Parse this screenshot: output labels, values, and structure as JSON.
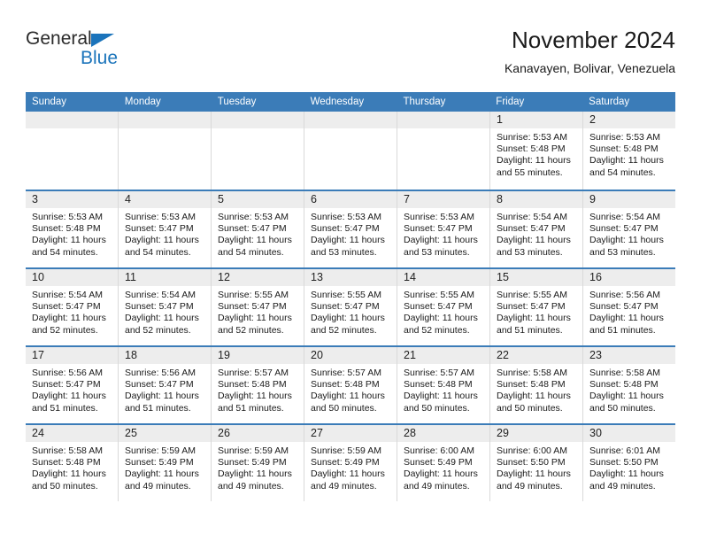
{
  "brand": {
    "name_part1": "General",
    "name_part2": "Blue",
    "accent_color": "#1b74bb"
  },
  "header": {
    "title": "November 2024",
    "subtitle": "Kanavayen, Bolivar, Venezuela"
  },
  "calendar": {
    "header_bg": "#3b7cb8",
    "daynum_bg": "#ededed",
    "weekdays": [
      "Sunday",
      "Monday",
      "Tuesday",
      "Wednesday",
      "Thursday",
      "Friday",
      "Saturday"
    ],
    "labels": {
      "sunrise": "Sunrise:",
      "sunset": "Sunset:",
      "daylight": "Daylight:"
    },
    "weeks": [
      [
        {
          "day": "",
          "empty": true
        },
        {
          "day": "",
          "empty": true
        },
        {
          "day": "",
          "empty": true
        },
        {
          "day": "",
          "empty": true
        },
        {
          "day": "",
          "empty": true
        },
        {
          "day": "1",
          "sunrise": "Sunrise: 5:53 AM",
          "sunset": "Sunset: 5:48 PM",
          "daylight": "Daylight: 11 hours and 55 minutes."
        },
        {
          "day": "2",
          "sunrise": "Sunrise: 5:53 AM",
          "sunset": "Sunset: 5:48 PM",
          "daylight": "Daylight: 11 hours and 54 minutes."
        }
      ],
      [
        {
          "day": "3",
          "sunrise": "Sunrise: 5:53 AM",
          "sunset": "Sunset: 5:48 PM",
          "daylight": "Daylight: 11 hours and 54 minutes."
        },
        {
          "day": "4",
          "sunrise": "Sunrise: 5:53 AM",
          "sunset": "Sunset: 5:47 PM",
          "daylight": "Daylight: 11 hours and 54 minutes."
        },
        {
          "day": "5",
          "sunrise": "Sunrise: 5:53 AM",
          "sunset": "Sunset: 5:47 PM",
          "daylight": "Daylight: 11 hours and 54 minutes."
        },
        {
          "day": "6",
          "sunrise": "Sunrise: 5:53 AM",
          "sunset": "Sunset: 5:47 PM",
          "daylight": "Daylight: 11 hours and 53 minutes."
        },
        {
          "day": "7",
          "sunrise": "Sunrise: 5:53 AM",
          "sunset": "Sunset: 5:47 PM",
          "daylight": "Daylight: 11 hours and 53 minutes."
        },
        {
          "day": "8",
          "sunrise": "Sunrise: 5:54 AM",
          "sunset": "Sunset: 5:47 PM",
          "daylight": "Daylight: 11 hours and 53 minutes."
        },
        {
          "day": "9",
          "sunrise": "Sunrise: 5:54 AM",
          "sunset": "Sunset: 5:47 PM",
          "daylight": "Daylight: 11 hours and 53 minutes."
        }
      ],
      [
        {
          "day": "10",
          "sunrise": "Sunrise: 5:54 AM",
          "sunset": "Sunset: 5:47 PM",
          "daylight": "Daylight: 11 hours and 52 minutes."
        },
        {
          "day": "11",
          "sunrise": "Sunrise: 5:54 AM",
          "sunset": "Sunset: 5:47 PM",
          "daylight": "Daylight: 11 hours and 52 minutes."
        },
        {
          "day": "12",
          "sunrise": "Sunrise: 5:55 AM",
          "sunset": "Sunset: 5:47 PM",
          "daylight": "Daylight: 11 hours and 52 minutes."
        },
        {
          "day": "13",
          "sunrise": "Sunrise: 5:55 AM",
          "sunset": "Sunset: 5:47 PM",
          "daylight": "Daylight: 11 hours and 52 minutes."
        },
        {
          "day": "14",
          "sunrise": "Sunrise: 5:55 AM",
          "sunset": "Sunset: 5:47 PM",
          "daylight": "Daylight: 11 hours and 52 minutes."
        },
        {
          "day": "15",
          "sunrise": "Sunrise: 5:55 AM",
          "sunset": "Sunset: 5:47 PM",
          "daylight": "Daylight: 11 hours and 51 minutes."
        },
        {
          "day": "16",
          "sunrise": "Sunrise: 5:56 AM",
          "sunset": "Sunset: 5:47 PM",
          "daylight": "Daylight: 11 hours and 51 minutes."
        }
      ],
      [
        {
          "day": "17",
          "sunrise": "Sunrise: 5:56 AM",
          "sunset": "Sunset: 5:47 PM",
          "daylight": "Daylight: 11 hours and 51 minutes."
        },
        {
          "day": "18",
          "sunrise": "Sunrise: 5:56 AM",
          "sunset": "Sunset: 5:47 PM",
          "daylight": "Daylight: 11 hours and 51 minutes."
        },
        {
          "day": "19",
          "sunrise": "Sunrise: 5:57 AM",
          "sunset": "Sunset: 5:48 PM",
          "daylight": "Daylight: 11 hours and 51 minutes."
        },
        {
          "day": "20",
          "sunrise": "Sunrise: 5:57 AM",
          "sunset": "Sunset: 5:48 PM",
          "daylight": "Daylight: 11 hours and 50 minutes."
        },
        {
          "day": "21",
          "sunrise": "Sunrise: 5:57 AM",
          "sunset": "Sunset: 5:48 PM",
          "daylight": "Daylight: 11 hours and 50 minutes."
        },
        {
          "day": "22",
          "sunrise": "Sunrise: 5:58 AM",
          "sunset": "Sunset: 5:48 PM",
          "daylight": "Daylight: 11 hours and 50 minutes."
        },
        {
          "day": "23",
          "sunrise": "Sunrise: 5:58 AM",
          "sunset": "Sunset: 5:48 PM",
          "daylight": "Daylight: 11 hours and 50 minutes."
        }
      ],
      [
        {
          "day": "24",
          "sunrise": "Sunrise: 5:58 AM",
          "sunset": "Sunset: 5:48 PM",
          "daylight": "Daylight: 11 hours and 50 minutes."
        },
        {
          "day": "25",
          "sunrise": "Sunrise: 5:59 AM",
          "sunset": "Sunset: 5:49 PM",
          "daylight": "Daylight: 11 hours and 49 minutes."
        },
        {
          "day": "26",
          "sunrise": "Sunrise: 5:59 AM",
          "sunset": "Sunset: 5:49 PM",
          "daylight": "Daylight: 11 hours and 49 minutes."
        },
        {
          "day": "27",
          "sunrise": "Sunrise: 5:59 AM",
          "sunset": "Sunset: 5:49 PM",
          "daylight": "Daylight: 11 hours and 49 minutes."
        },
        {
          "day": "28",
          "sunrise": "Sunrise: 6:00 AM",
          "sunset": "Sunset: 5:49 PM",
          "daylight": "Daylight: 11 hours and 49 minutes."
        },
        {
          "day": "29",
          "sunrise": "Sunrise: 6:00 AM",
          "sunset": "Sunset: 5:50 PM",
          "daylight": "Daylight: 11 hours and 49 minutes."
        },
        {
          "day": "30",
          "sunrise": "Sunrise: 6:01 AM",
          "sunset": "Sunset: 5:50 PM",
          "daylight": "Daylight: 11 hours and 49 minutes."
        }
      ]
    ]
  }
}
